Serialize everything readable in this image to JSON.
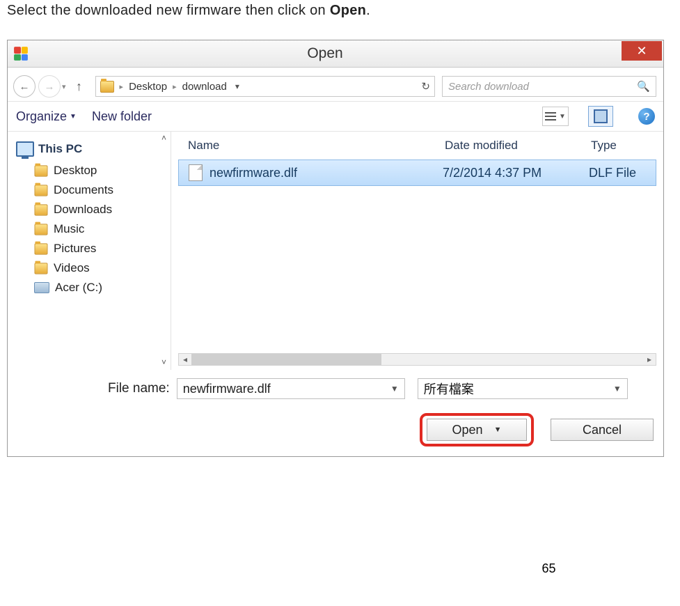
{
  "instruction": {
    "pre": "Select the downloaded new firmware then click on ",
    "bold": "Open",
    "post": "."
  },
  "dialog": {
    "title": "Open",
    "breadcrumb": {
      "seg1": "Desktop",
      "seg2": "download"
    },
    "search": {
      "placeholder": "Search download"
    },
    "toolbar": {
      "organize": "Organize",
      "newfolder": "New folder",
      "help": "?"
    },
    "columns": {
      "name": "Name",
      "date": "Date modified",
      "type": "Type"
    },
    "tree": {
      "root": "This PC",
      "items": [
        "Desktop",
        "Documents",
        "Downloads",
        "Music",
        "Pictures",
        "Videos",
        "Acer (C:)"
      ]
    },
    "files": [
      {
        "name": "newfirmware.dlf",
        "date": "7/2/2014 4:37 PM",
        "type": "DLF File"
      }
    ],
    "filename_label": "File name:",
    "filename_value": "newfirmware.dlf",
    "filter_value": "所有檔案",
    "open_btn": "Open",
    "cancel_btn": "Cancel"
  },
  "page_number": "65"
}
